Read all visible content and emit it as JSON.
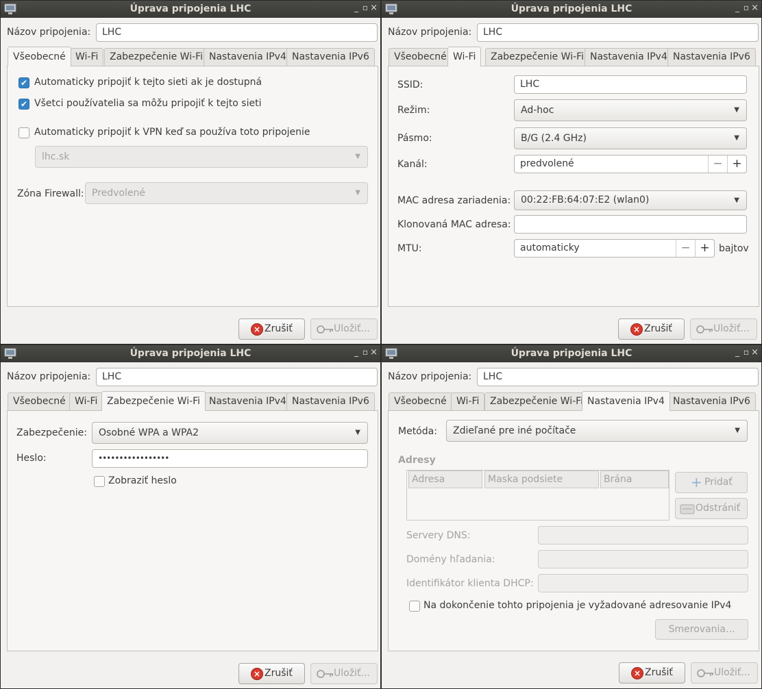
{
  "window_title": "Úprava pripojenia LHC",
  "connection_name_label": "Názov pripojenia:",
  "connection_name_value": "LHC",
  "tabs": [
    "Všeobecné",
    "Wi-Fi",
    "Zabezpečenie Wi-Fi",
    "Nastavenia IPv4",
    "Nastavenia IPv6"
  ],
  "buttons": {
    "cancel": "Zrušiť",
    "save": "Uložiť..."
  },
  "window_controls": {
    "minimize": "_",
    "maximize": "▫",
    "close": "×"
  },
  "icons": {
    "cancel": "cancel-icon",
    "save": "key-icon",
    "add": "plus-icon",
    "remove": "delete-icon",
    "combo": "chevron-down-icon",
    "checked": "✔"
  },
  "general": {
    "auto_connect": "Automaticky pripojiť k tejto sieti ak je dostupná",
    "all_users": "Všetci používatelia sa môžu pripojiť k tejto sieti",
    "auto_vpn": "Automaticky pripojiť k VPN keď sa používa toto pripojenie",
    "vpn_value": "lhc.sk",
    "firewall_label": "Zóna Firewall:",
    "firewall_value": "Predvolené"
  },
  "wifi": {
    "ssid_label": "SSID:",
    "ssid_value": "LHC",
    "mode_label": "Režim:",
    "mode_value": "Ad-hoc",
    "band_label": "Pásmo:",
    "band_value": "B/G (2.4 GHz)",
    "channel_label": "Kanál:",
    "channel_value": "predvolené",
    "mac_label": "MAC adresa zariadenia:",
    "mac_value": "00:22:FB:64:07:E2 (wlan0)",
    "cloned_mac_label": "Klonovaná MAC adresa:",
    "cloned_mac_value": "",
    "mtu_label": "MTU:",
    "mtu_value": "automaticky",
    "mtu_unit": "bajtov"
  },
  "security": {
    "security_label": "Zabezpečenie:",
    "security_value": "Osobné WPA a WPA2",
    "password_label": "Heslo:",
    "password_value": "•••••••••••••••••",
    "show_password": "Zobraziť heslo"
  },
  "ipv4": {
    "method_label": "Metóda:",
    "method_value": "Zdieľané pre iné počítače",
    "addresses_heading": "Adresy",
    "columns": [
      "Adresa",
      "Maska podsiete",
      "Brána"
    ],
    "add_button": "Pridať",
    "remove_button": "Odstrániť",
    "dns_label": "Servery DNS:",
    "search_domains_label": "Domény hľadania:",
    "dhcp_id_label": "Identifikátor klienta DHCP:",
    "require_ipv4": "Na dokončenie tohto pripojenia je vyžadované adresovanie IPv4",
    "routes_button": "Smerovania..."
  }
}
